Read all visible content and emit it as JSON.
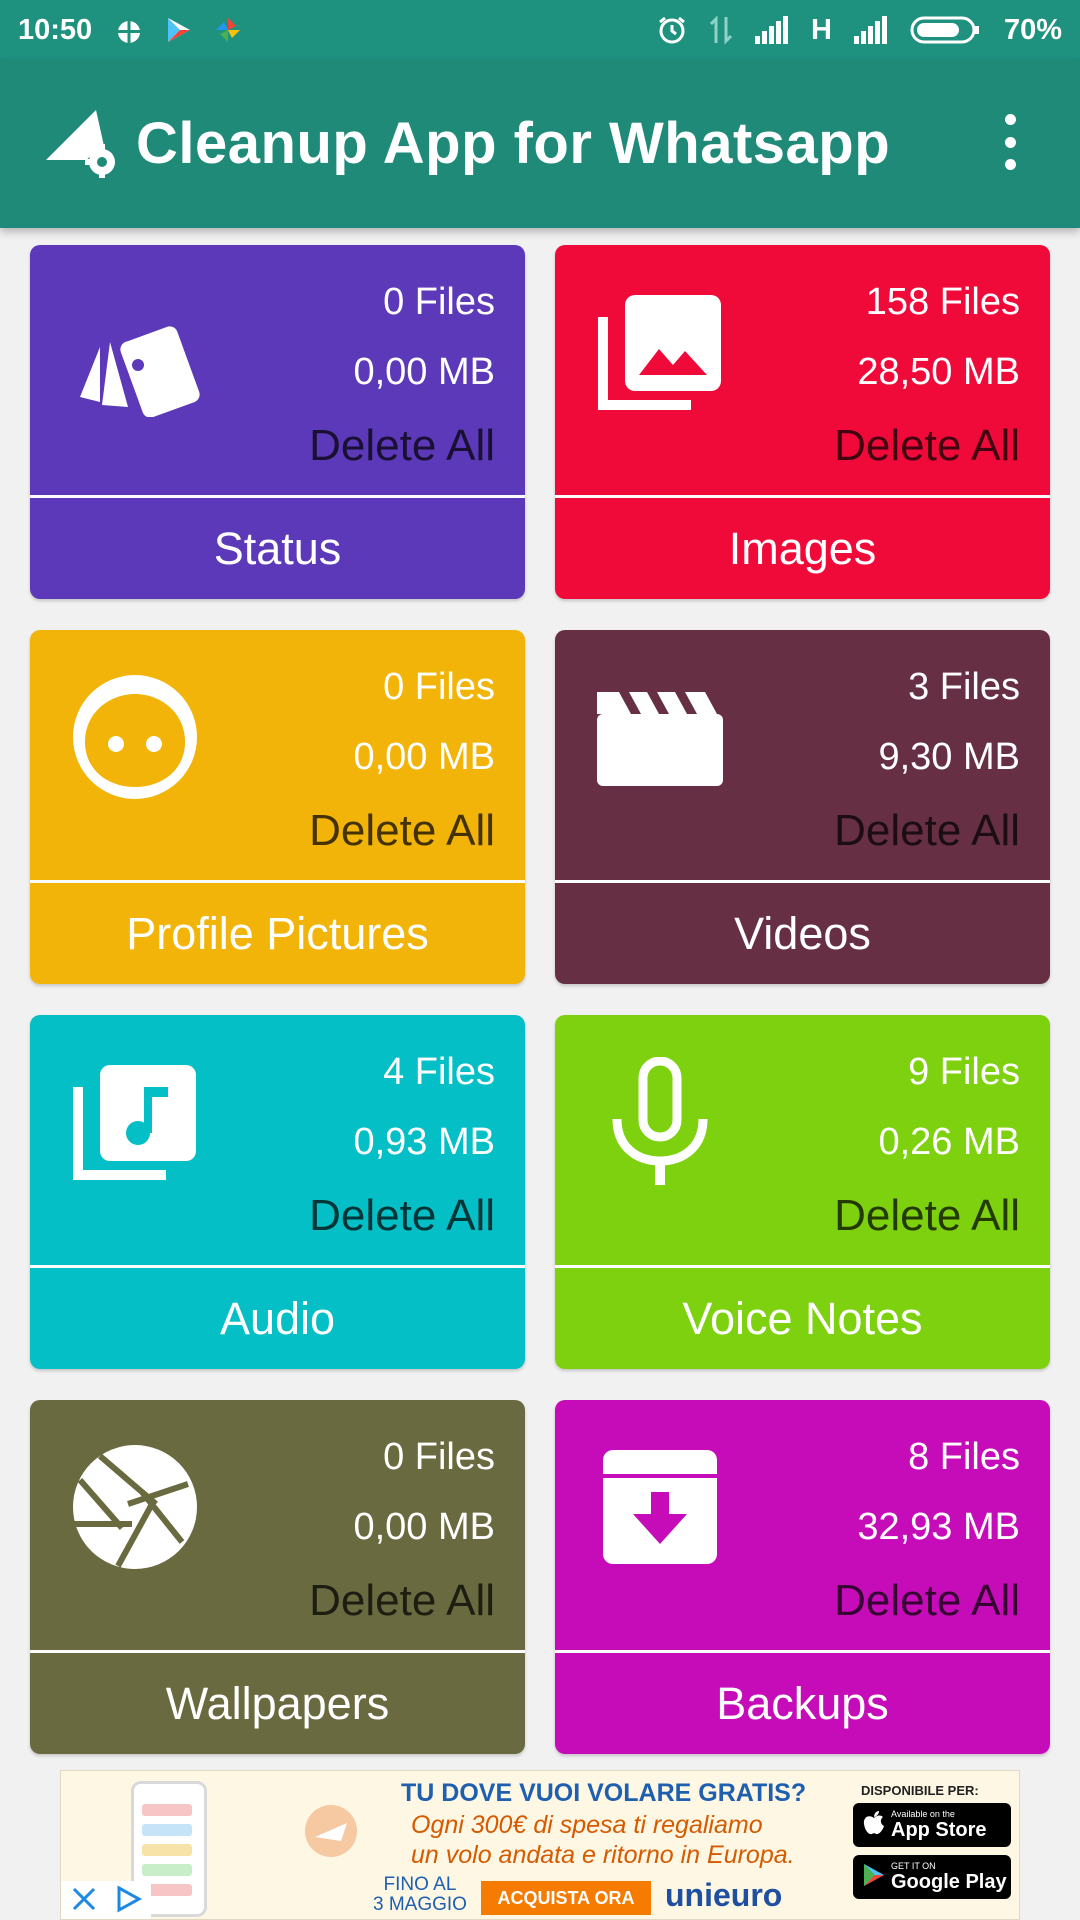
{
  "status_bar": {
    "time": "10:50",
    "network": "H",
    "battery": "70%"
  },
  "app_bar": {
    "title": "Cleanup App for Whatsapp"
  },
  "cards": [
    {
      "label": "Status",
      "files": "0 Files",
      "size": "0,00 MB",
      "delete": "Delete All",
      "color": "#5c39b9",
      "icon": "status-cards-icon"
    },
    {
      "label": "Images",
      "files": "158 Files",
      "size": "28,50 MB",
      "delete": "Delete All",
      "color": "#ef0a3a",
      "icon": "images-icon"
    },
    {
      "label": "Profile Pictures",
      "files": "0 Files",
      "size": "0,00 MB",
      "delete": "Delete All",
      "color": "#f2b408",
      "icon": "face-icon"
    },
    {
      "label": "Videos",
      "files": "3 Files",
      "size": "9,30 MB",
      "delete": "Delete All",
      "color": "#662f43",
      "icon": "clapperboard-icon"
    },
    {
      "label": "Audio",
      "files": "4 Files",
      "size": "0,93 MB",
      "delete": "Delete All",
      "color": "#05bfc6",
      "icon": "music-library-icon"
    },
    {
      "label": "Voice Notes",
      "files": "9 Files",
      "size": "0,26 MB",
      "delete": "Delete All",
      "color": "#7ed10e",
      "icon": "microphone-icon"
    },
    {
      "label": "Wallpapers",
      "files": "0 Files",
      "size": "0,00 MB",
      "delete": "Delete All",
      "color": "#6a6a40",
      "icon": "shutter-icon"
    },
    {
      "label": "Backups",
      "files": "8 Files",
      "size": "32,93 MB",
      "delete": "Delete All",
      "color": "#c60cb8",
      "icon": "archive-download-icon"
    }
  ],
  "ad": {
    "headline": "TU DOVE VUOI VOLARE GRATIS?",
    "line1": "Ogni 300€ di spesa ti regaliamo",
    "line2": "un volo andata e ritorno in Europa.",
    "fino_1": "FINO AL",
    "fino_2": "3 MAGGIO",
    "cta": "ACQUISTA ORA",
    "brand": "unieuro",
    "available": "DISPONIBILE PER:",
    "appstore_small": "Available on the",
    "appstore_big": "App Store",
    "play_small": "GET IT ON",
    "play_big": "Google Play"
  }
}
